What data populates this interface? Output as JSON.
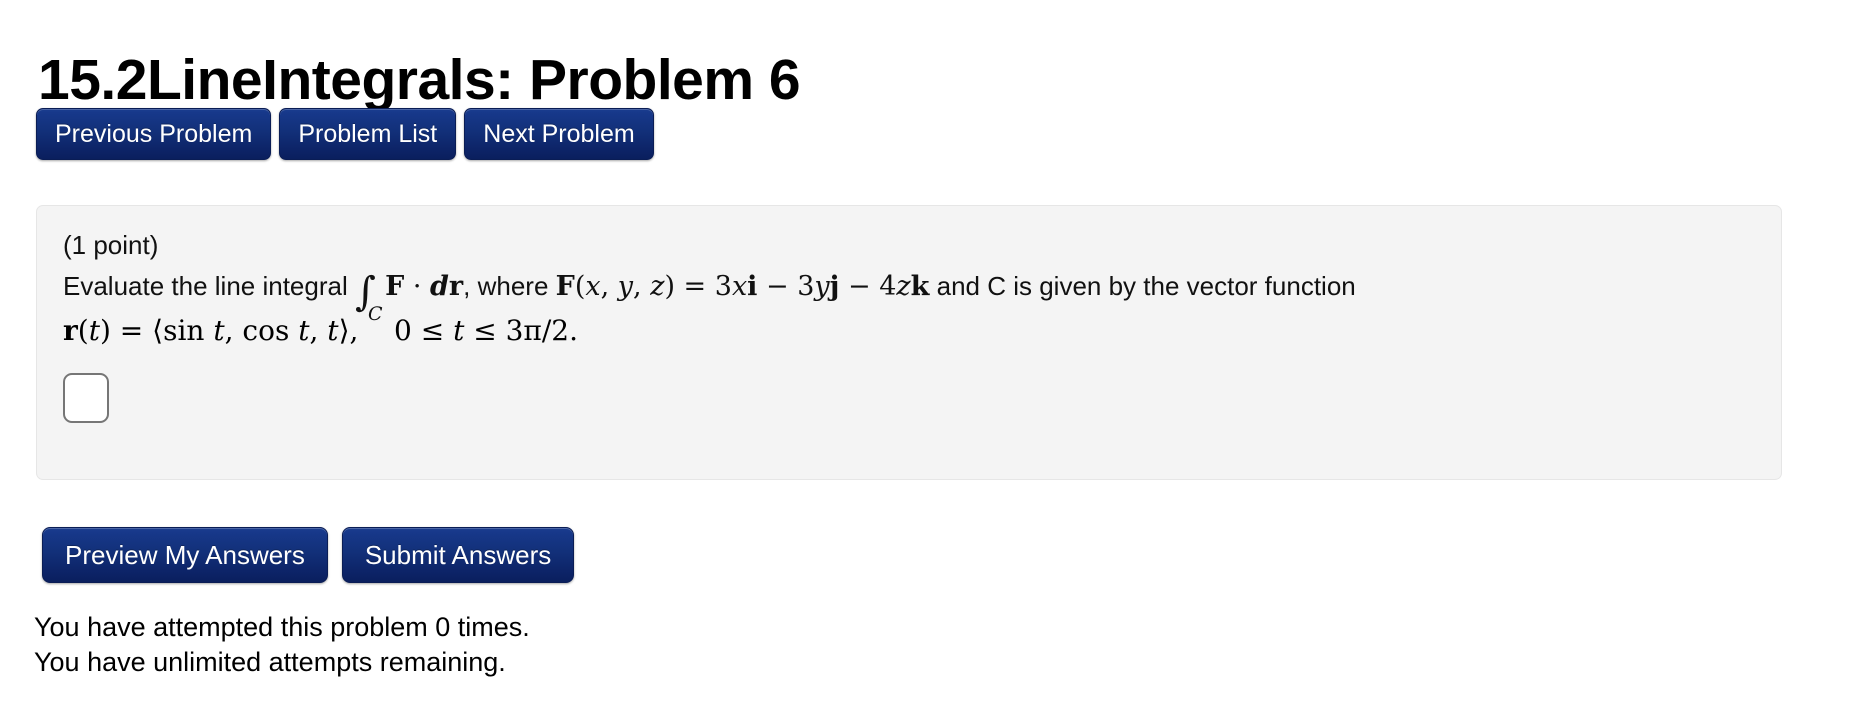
{
  "header": {
    "title": "15.2LineIntegrals: Problem 6"
  },
  "nav_buttons": [
    {
      "label": "Previous Problem",
      "name": "previous-problem-button"
    },
    {
      "label": "Problem List",
      "name": "problem-list-button"
    },
    {
      "label": "Next Problem",
      "name": "next-problem-button"
    }
  ],
  "problem": {
    "points_label": "(1 point)",
    "prompt_prefix": "Evaluate the line integral",
    "integral_symbol": "∫",
    "integral_subscript": "C",
    "integrand": "F · dr",
    "prompt_middle": ", where",
    "field_definition": "F(x, y, z) = 3xi − 3yj − 4zk",
    "prompt_suffix": "and C is given by the vector function",
    "parametrization": "r(t) = ⟨sin t, cos t, t⟩,",
    "domain_condition": "0 ≤ t ≤ 3π/2.",
    "answer_value": "",
    "answer_placeholder": ""
  },
  "actions": [
    {
      "label": "Preview My Answers",
      "name": "preview-my-answers-button"
    },
    {
      "label": "Submit Answers",
      "name": "submit-answers-button"
    }
  ],
  "status": {
    "attempts_line": "You have attempted this problem 0 times.",
    "remaining_line": "You have unlimited attempts remaining."
  },
  "colors": {
    "button_navy_top": "#1b3d8f",
    "button_navy_bottom": "#0a1f5e",
    "box_background": "#f4f4f4",
    "box_border": "#e6e6e6",
    "input_border": "#767676",
    "text": "#000000"
  }
}
